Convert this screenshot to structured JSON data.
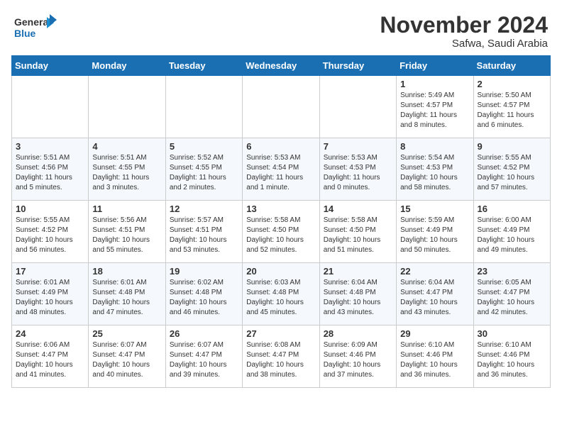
{
  "header": {
    "logo_line1": "General",
    "logo_line2": "Blue",
    "month": "November 2024",
    "location": "Safwa, Saudi Arabia"
  },
  "weekdays": [
    "Sunday",
    "Monday",
    "Tuesday",
    "Wednesday",
    "Thursday",
    "Friday",
    "Saturday"
  ],
  "weeks": [
    [
      {
        "day": "",
        "info": ""
      },
      {
        "day": "",
        "info": ""
      },
      {
        "day": "",
        "info": ""
      },
      {
        "day": "",
        "info": ""
      },
      {
        "day": "",
        "info": ""
      },
      {
        "day": "1",
        "info": "Sunrise: 5:49 AM\nSunset: 4:57 PM\nDaylight: 11 hours\nand 8 minutes."
      },
      {
        "day": "2",
        "info": "Sunrise: 5:50 AM\nSunset: 4:57 PM\nDaylight: 11 hours\nand 6 minutes."
      }
    ],
    [
      {
        "day": "3",
        "info": "Sunrise: 5:51 AM\nSunset: 4:56 PM\nDaylight: 11 hours\nand 5 minutes."
      },
      {
        "day": "4",
        "info": "Sunrise: 5:51 AM\nSunset: 4:55 PM\nDaylight: 11 hours\nand 3 minutes."
      },
      {
        "day": "5",
        "info": "Sunrise: 5:52 AM\nSunset: 4:55 PM\nDaylight: 11 hours\nand 2 minutes."
      },
      {
        "day": "6",
        "info": "Sunrise: 5:53 AM\nSunset: 4:54 PM\nDaylight: 11 hours\nand 1 minute."
      },
      {
        "day": "7",
        "info": "Sunrise: 5:53 AM\nSunset: 4:53 PM\nDaylight: 11 hours\nand 0 minutes."
      },
      {
        "day": "8",
        "info": "Sunrise: 5:54 AM\nSunset: 4:53 PM\nDaylight: 10 hours\nand 58 minutes."
      },
      {
        "day": "9",
        "info": "Sunrise: 5:55 AM\nSunset: 4:52 PM\nDaylight: 10 hours\nand 57 minutes."
      }
    ],
    [
      {
        "day": "10",
        "info": "Sunrise: 5:55 AM\nSunset: 4:52 PM\nDaylight: 10 hours\nand 56 minutes."
      },
      {
        "day": "11",
        "info": "Sunrise: 5:56 AM\nSunset: 4:51 PM\nDaylight: 10 hours\nand 55 minutes."
      },
      {
        "day": "12",
        "info": "Sunrise: 5:57 AM\nSunset: 4:51 PM\nDaylight: 10 hours\nand 53 minutes."
      },
      {
        "day": "13",
        "info": "Sunrise: 5:58 AM\nSunset: 4:50 PM\nDaylight: 10 hours\nand 52 minutes."
      },
      {
        "day": "14",
        "info": "Sunrise: 5:58 AM\nSunset: 4:50 PM\nDaylight: 10 hours\nand 51 minutes."
      },
      {
        "day": "15",
        "info": "Sunrise: 5:59 AM\nSunset: 4:49 PM\nDaylight: 10 hours\nand 50 minutes."
      },
      {
        "day": "16",
        "info": "Sunrise: 6:00 AM\nSunset: 4:49 PM\nDaylight: 10 hours\nand 49 minutes."
      }
    ],
    [
      {
        "day": "17",
        "info": "Sunrise: 6:01 AM\nSunset: 4:49 PM\nDaylight: 10 hours\nand 48 minutes."
      },
      {
        "day": "18",
        "info": "Sunrise: 6:01 AM\nSunset: 4:48 PM\nDaylight: 10 hours\nand 47 minutes."
      },
      {
        "day": "19",
        "info": "Sunrise: 6:02 AM\nSunset: 4:48 PM\nDaylight: 10 hours\nand 46 minutes."
      },
      {
        "day": "20",
        "info": "Sunrise: 6:03 AM\nSunset: 4:48 PM\nDaylight: 10 hours\nand 45 minutes."
      },
      {
        "day": "21",
        "info": "Sunrise: 6:04 AM\nSunset: 4:48 PM\nDaylight: 10 hours\nand 43 minutes."
      },
      {
        "day": "22",
        "info": "Sunrise: 6:04 AM\nSunset: 4:47 PM\nDaylight: 10 hours\nand 43 minutes."
      },
      {
        "day": "23",
        "info": "Sunrise: 6:05 AM\nSunset: 4:47 PM\nDaylight: 10 hours\nand 42 minutes."
      }
    ],
    [
      {
        "day": "24",
        "info": "Sunrise: 6:06 AM\nSunset: 4:47 PM\nDaylight: 10 hours\nand 41 minutes."
      },
      {
        "day": "25",
        "info": "Sunrise: 6:07 AM\nSunset: 4:47 PM\nDaylight: 10 hours\nand 40 minutes."
      },
      {
        "day": "26",
        "info": "Sunrise: 6:07 AM\nSunset: 4:47 PM\nDaylight: 10 hours\nand 39 minutes."
      },
      {
        "day": "27",
        "info": "Sunrise: 6:08 AM\nSunset: 4:47 PM\nDaylight: 10 hours\nand 38 minutes."
      },
      {
        "day": "28",
        "info": "Sunrise: 6:09 AM\nSunset: 4:46 PM\nDaylight: 10 hours\nand 37 minutes."
      },
      {
        "day": "29",
        "info": "Sunrise: 6:10 AM\nSunset: 4:46 PM\nDaylight: 10 hours\nand 36 minutes."
      },
      {
        "day": "30",
        "info": "Sunrise: 6:10 AM\nSunset: 4:46 PM\nDaylight: 10 hours\nand 36 minutes."
      }
    ]
  ]
}
